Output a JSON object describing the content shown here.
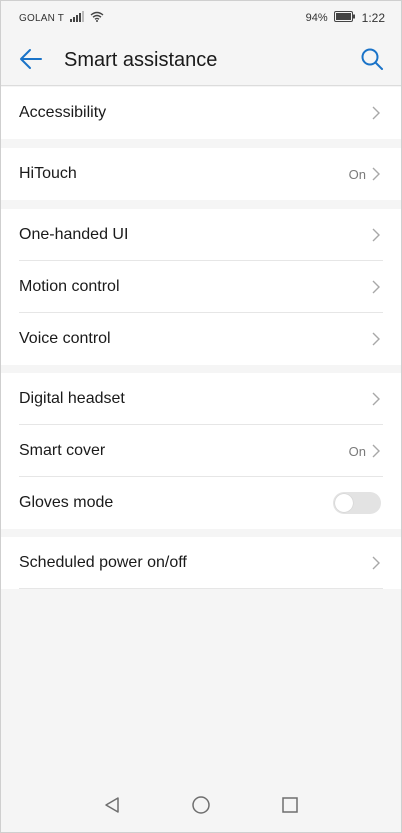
{
  "status_bar": {
    "carrier": "GOLAN T",
    "battery_percent": "94%",
    "time": "1:22"
  },
  "header": {
    "title": "Smart assistance",
    "back_icon": "arrow-left-icon",
    "search_icon": "search-icon"
  },
  "colors": {
    "accent": "#1a73c8",
    "background": "#f5f5f5",
    "row_background": "#ffffff",
    "secondary_text": "#7a7a7a",
    "toggle_off": "#e3e3e3"
  },
  "groups": [
    {
      "items": [
        {
          "label": "Accessibility"
        }
      ]
    },
    {
      "items": [
        {
          "label": "HiTouch",
          "value": "On"
        }
      ]
    },
    {
      "items": [
        {
          "label": "One-handed UI"
        },
        {
          "label": "Motion control"
        },
        {
          "label": "Voice control"
        }
      ]
    },
    {
      "items": [
        {
          "label": "Digital headset"
        },
        {
          "label": "Smart cover",
          "value": "On"
        },
        {
          "label": "Gloves mode",
          "toggle": false
        }
      ]
    },
    {
      "items": [
        {
          "label": "Scheduled power on/off"
        }
      ]
    }
  ],
  "nav_bar": {
    "back_icon": "triangle-back-icon",
    "home_icon": "circle-home-icon",
    "recents_icon": "square-recents-icon"
  }
}
